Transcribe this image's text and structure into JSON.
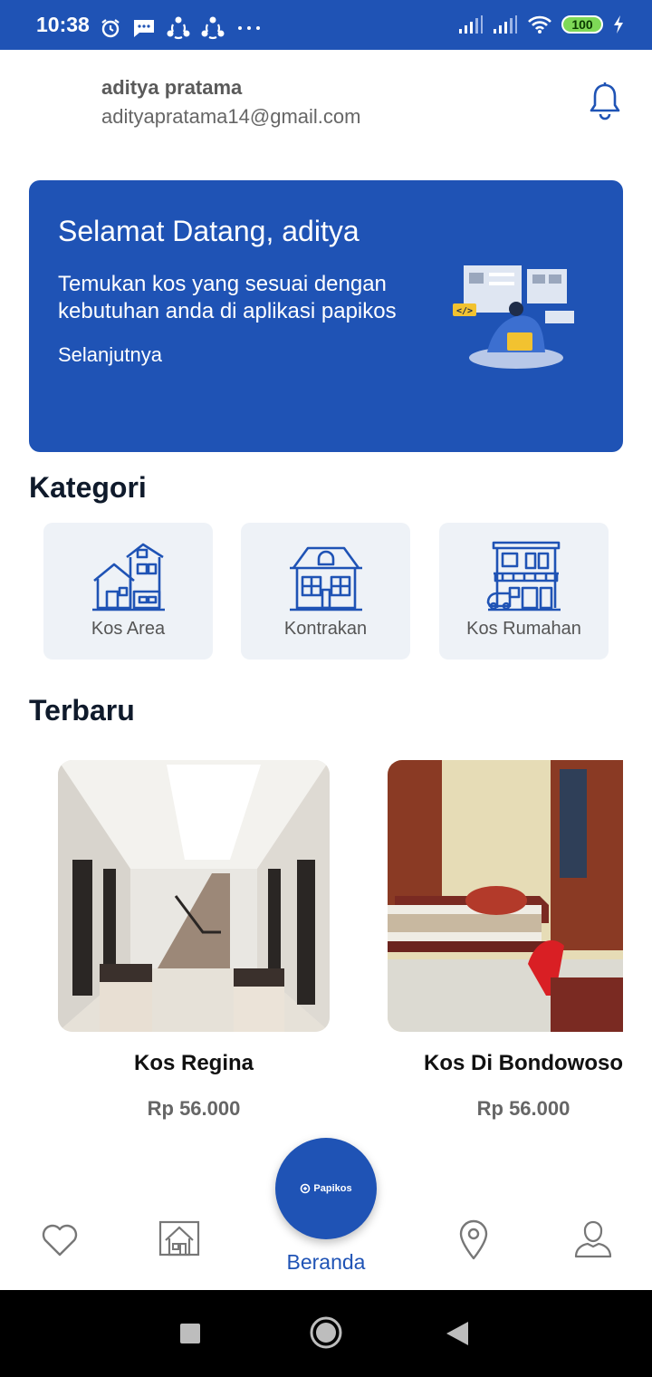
{
  "status_bar": {
    "time": "10:38",
    "battery": "100",
    "colors": {
      "background": "#1f53b5",
      "battery_fill": "#7ed957"
    },
    "icons": [
      "alarm-icon",
      "message-icon",
      "sync-icon",
      "sync-icon",
      "more-dots-icon",
      "signal-icon",
      "signal-icon",
      "wifi-icon",
      "battery-icon",
      "charging-icon"
    ]
  },
  "header": {
    "user_name": "aditya pratama",
    "user_email": "adityapratama14@gmail.com",
    "notification_icon": "bell-icon"
  },
  "banner": {
    "title": "Selamat Datang, aditya",
    "text": "Temukan kos yang sesuai dengan kebutuhan anda di aplikasi papikos",
    "next_link": "Selanjutnya",
    "code_tag": "</>",
    "color": "#1f53b5"
  },
  "categories": {
    "title": "Kategori",
    "items": [
      {
        "label": "Kos Area",
        "icon": "houses-icon"
      },
      {
        "label": "Kontrakan",
        "icon": "house-icon"
      },
      {
        "label": "Kos Rumahan",
        "icon": "building-icon"
      }
    ]
  },
  "latest": {
    "title": "Terbaru",
    "items": [
      {
        "name": "Kos Regina",
        "price": "Rp 56.000"
      },
      {
        "name": "Kos Di Bondowoso",
        "price": "Rp 56.000"
      }
    ]
  },
  "bottom_nav": {
    "active_label": "Beranda",
    "fab_logo_text": "Papikos",
    "icons": [
      "heart-icon",
      "house-icon",
      "location-pin-icon",
      "profile-icon"
    ],
    "active_color": "#1f53b5"
  },
  "system_nav": {
    "icons": [
      "recent-apps-icon",
      "home-icon",
      "back-icon"
    ]
  }
}
